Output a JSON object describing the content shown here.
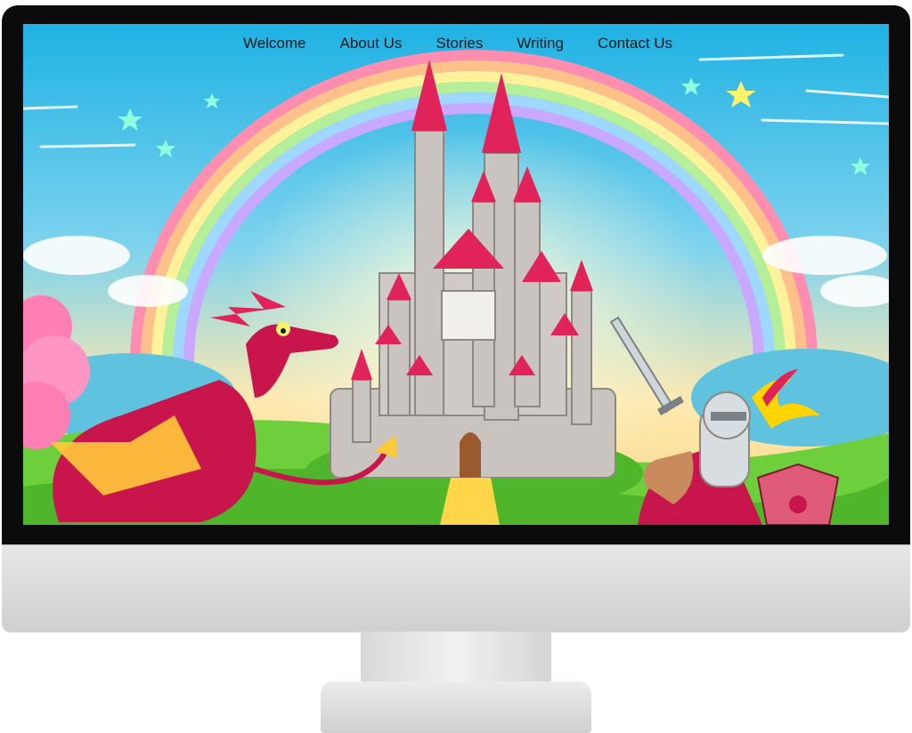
{
  "nav": {
    "items": [
      {
        "label": "Welcome"
      },
      {
        "label": "About Us"
      },
      {
        "label": "Stories"
      },
      {
        "label": "Writing"
      },
      {
        "label": "Contact Us"
      }
    ]
  },
  "hero": {
    "icons": [
      "rainbow",
      "castle",
      "dragon",
      "knight",
      "shield",
      "sword",
      "stars",
      "clouds"
    ]
  },
  "colors": {
    "sky": "#2bb6e0",
    "castle": "#c9c4bf",
    "roof": "#e0245a",
    "dragon": "#c8164c",
    "grass": "#6ecf3c"
  }
}
